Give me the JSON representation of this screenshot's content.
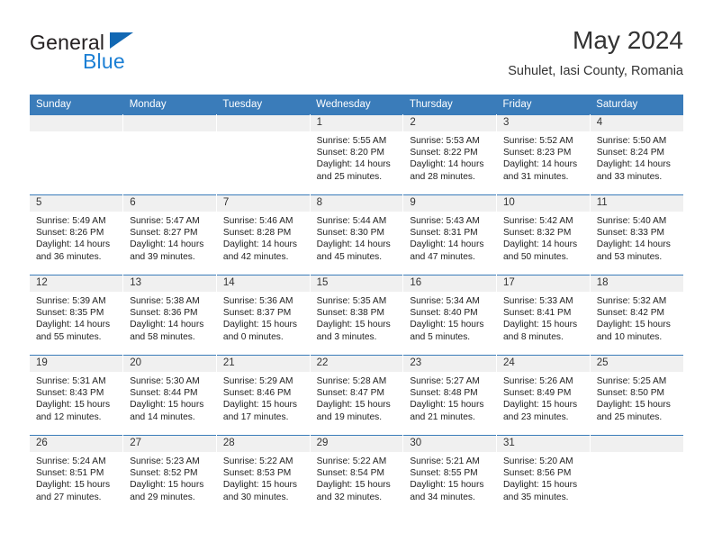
{
  "logo": {
    "word_top": "General",
    "word_bottom": "Blue",
    "triangle_color": "#1268b3",
    "blue_color": "#1b7fd4"
  },
  "header": {
    "month_title": "May 2024",
    "location": "Suhulet, Iasi County, Romania"
  },
  "colors": {
    "header_blue": "#3a7cba",
    "daynum_band": "#f0f0f0"
  },
  "weekday_headers": [
    "Sunday",
    "Monday",
    "Tuesday",
    "Wednesday",
    "Thursday",
    "Friday",
    "Saturday"
  ],
  "weeks": [
    [
      {
        "day": "",
        "empty": true,
        "sunrise": "",
        "sunset": "",
        "daylight_line1": "",
        "daylight_line2": ""
      },
      {
        "day": "",
        "empty": true,
        "sunrise": "",
        "sunset": "",
        "daylight_line1": "",
        "daylight_line2": ""
      },
      {
        "day": "",
        "empty": true,
        "sunrise": "",
        "sunset": "",
        "daylight_line1": "",
        "daylight_line2": ""
      },
      {
        "day": "1",
        "empty": false,
        "sunrise": "Sunrise: 5:55 AM",
        "sunset": "Sunset: 8:20 PM",
        "daylight_line1": "Daylight: 14 hours",
        "daylight_line2": "and 25 minutes."
      },
      {
        "day": "2",
        "empty": false,
        "sunrise": "Sunrise: 5:53 AM",
        "sunset": "Sunset: 8:22 PM",
        "daylight_line1": "Daylight: 14 hours",
        "daylight_line2": "and 28 minutes."
      },
      {
        "day": "3",
        "empty": false,
        "sunrise": "Sunrise: 5:52 AM",
        "sunset": "Sunset: 8:23 PM",
        "daylight_line1": "Daylight: 14 hours",
        "daylight_line2": "and 31 minutes."
      },
      {
        "day": "4",
        "empty": false,
        "sunrise": "Sunrise: 5:50 AM",
        "sunset": "Sunset: 8:24 PM",
        "daylight_line1": "Daylight: 14 hours",
        "daylight_line2": "and 33 minutes."
      }
    ],
    [
      {
        "day": "5",
        "empty": false,
        "sunrise": "Sunrise: 5:49 AM",
        "sunset": "Sunset: 8:26 PM",
        "daylight_line1": "Daylight: 14 hours",
        "daylight_line2": "and 36 minutes."
      },
      {
        "day": "6",
        "empty": false,
        "sunrise": "Sunrise: 5:47 AM",
        "sunset": "Sunset: 8:27 PM",
        "daylight_line1": "Daylight: 14 hours",
        "daylight_line2": "and 39 minutes."
      },
      {
        "day": "7",
        "empty": false,
        "sunrise": "Sunrise: 5:46 AM",
        "sunset": "Sunset: 8:28 PM",
        "daylight_line1": "Daylight: 14 hours",
        "daylight_line2": "and 42 minutes."
      },
      {
        "day": "8",
        "empty": false,
        "sunrise": "Sunrise: 5:44 AM",
        "sunset": "Sunset: 8:30 PM",
        "daylight_line1": "Daylight: 14 hours",
        "daylight_line2": "and 45 minutes."
      },
      {
        "day": "9",
        "empty": false,
        "sunrise": "Sunrise: 5:43 AM",
        "sunset": "Sunset: 8:31 PM",
        "daylight_line1": "Daylight: 14 hours",
        "daylight_line2": "and 47 minutes."
      },
      {
        "day": "10",
        "empty": false,
        "sunrise": "Sunrise: 5:42 AM",
        "sunset": "Sunset: 8:32 PM",
        "daylight_line1": "Daylight: 14 hours",
        "daylight_line2": "and 50 minutes."
      },
      {
        "day": "11",
        "empty": false,
        "sunrise": "Sunrise: 5:40 AM",
        "sunset": "Sunset: 8:33 PM",
        "daylight_line1": "Daylight: 14 hours",
        "daylight_line2": "and 53 minutes."
      }
    ],
    [
      {
        "day": "12",
        "empty": false,
        "sunrise": "Sunrise: 5:39 AM",
        "sunset": "Sunset: 8:35 PM",
        "daylight_line1": "Daylight: 14 hours",
        "daylight_line2": "and 55 minutes."
      },
      {
        "day": "13",
        "empty": false,
        "sunrise": "Sunrise: 5:38 AM",
        "sunset": "Sunset: 8:36 PM",
        "daylight_line1": "Daylight: 14 hours",
        "daylight_line2": "and 58 minutes."
      },
      {
        "day": "14",
        "empty": false,
        "sunrise": "Sunrise: 5:36 AM",
        "sunset": "Sunset: 8:37 PM",
        "daylight_line1": "Daylight: 15 hours",
        "daylight_line2": "and 0 minutes."
      },
      {
        "day": "15",
        "empty": false,
        "sunrise": "Sunrise: 5:35 AM",
        "sunset": "Sunset: 8:38 PM",
        "daylight_line1": "Daylight: 15 hours",
        "daylight_line2": "and 3 minutes."
      },
      {
        "day": "16",
        "empty": false,
        "sunrise": "Sunrise: 5:34 AM",
        "sunset": "Sunset: 8:40 PM",
        "daylight_line1": "Daylight: 15 hours",
        "daylight_line2": "and 5 minutes."
      },
      {
        "day": "17",
        "empty": false,
        "sunrise": "Sunrise: 5:33 AM",
        "sunset": "Sunset: 8:41 PM",
        "daylight_line1": "Daylight: 15 hours",
        "daylight_line2": "and 8 minutes."
      },
      {
        "day": "18",
        "empty": false,
        "sunrise": "Sunrise: 5:32 AM",
        "sunset": "Sunset: 8:42 PM",
        "daylight_line1": "Daylight: 15 hours",
        "daylight_line2": "and 10 minutes."
      }
    ],
    [
      {
        "day": "19",
        "empty": false,
        "sunrise": "Sunrise: 5:31 AM",
        "sunset": "Sunset: 8:43 PM",
        "daylight_line1": "Daylight: 15 hours",
        "daylight_line2": "and 12 minutes."
      },
      {
        "day": "20",
        "empty": false,
        "sunrise": "Sunrise: 5:30 AM",
        "sunset": "Sunset: 8:44 PM",
        "daylight_line1": "Daylight: 15 hours",
        "daylight_line2": "and 14 minutes."
      },
      {
        "day": "21",
        "empty": false,
        "sunrise": "Sunrise: 5:29 AM",
        "sunset": "Sunset: 8:46 PM",
        "daylight_line1": "Daylight: 15 hours",
        "daylight_line2": "and 17 minutes."
      },
      {
        "day": "22",
        "empty": false,
        "sunrise": "Sunrise: 5:28 AM",
        "sunset": "Sunset: 8:47 PM",
        "daylight_line1": "Daylight: 15 hours",
        "daylight_line2": "and 19 minutes."
      },
      {
        "day": "23",
        "empty": false,
        "sunrise": "Sunrise: 5:27 AM",
        "sunset": "Sunset: 8:48 PM",
        "daylight_line1": "Daylight: 15 hours",
        "daylight_line2": "and 21 minutes."
      },
      {
        "day": "24",
        "empty": false,
        "sunrise": "Sunrise: 5:26 AM",
        "sunset": "Sunset: 8:49 PM",
        "daylight_line1": "Daylight: 15 hours",
        "daylight_line2": "and 23 minutes."
      },
      {
        "day": "25",
        "empty": false,
        "sunrise": "Sunrise: 5:25 AM",
        "sunset": "Sunset: 8:50 PM",
        "daylight_line1": "Daylight: 15 hours",
        "daylight_line2": "and 25 minutes."
      }
    ],
    [
      {
        "day": "26",
        "empty": false,
        "sunrise": "Sunrise: 5:24 AM",
        "sunset": "Sunset: 8:51 PM",
        "daylight_line1": "Daylight: 15 hours",
        "daylight_line2": "and 27 minutes."
      },
      {
        "day": "27",
        "empty": false,
        "sunrise": "Sunrise: 5:23 AM",
        "sunset": "Sunset: 8:52 PM",
        "daylight_line1": "Daylight: 15 hours",
        "daylight_line2": "and 29 minutes."
      },
      {
        "day": "28",
        "empty": false,
        "sunrise": "Sunrise: 5:22 AM",
        "sunset": "Sunset: 8:53 PM",
        "daylight_line1": "Daylight: 15 hours",
        "daylight_line2": "and 30 minutes."
      },
      {
        "day": "29",
        "empty": false,
        "sunrise": "Sunrise: 5:22 AM",
        "sunset": "Sunset: 8:54 PM",
        "daylight_line1": "Daylight: 15 hours",
        "daylight_line2": "and 32 minutes."
      },
      {
        "day": "30",
        "empty": false,
        "sunrise": "Sunrise: 5:21 AM",
        "sunset": "Sunset: 8:55 PM",
        "daylight_line1": "Daylight: 15 hours",
        "daylight_line2": "and 34 minutes."
      },
      {
        "day": "31",
        "empty": false,
        "sunrise": "Sunrise: 5:20 AM",
        "sunset": "Sunset: 8:56 PM",
        "daylight_line1": "Daylight: 15 hours",
        "daylight_line2": "and 35 minutes."
      },
      {
        "day": "",
        "empty": true,
        "sunrise": "",
        "sunset": "",
        "daylight_line1": "",
        "daylight_line2": ""
      }
    ]
  ]
}
